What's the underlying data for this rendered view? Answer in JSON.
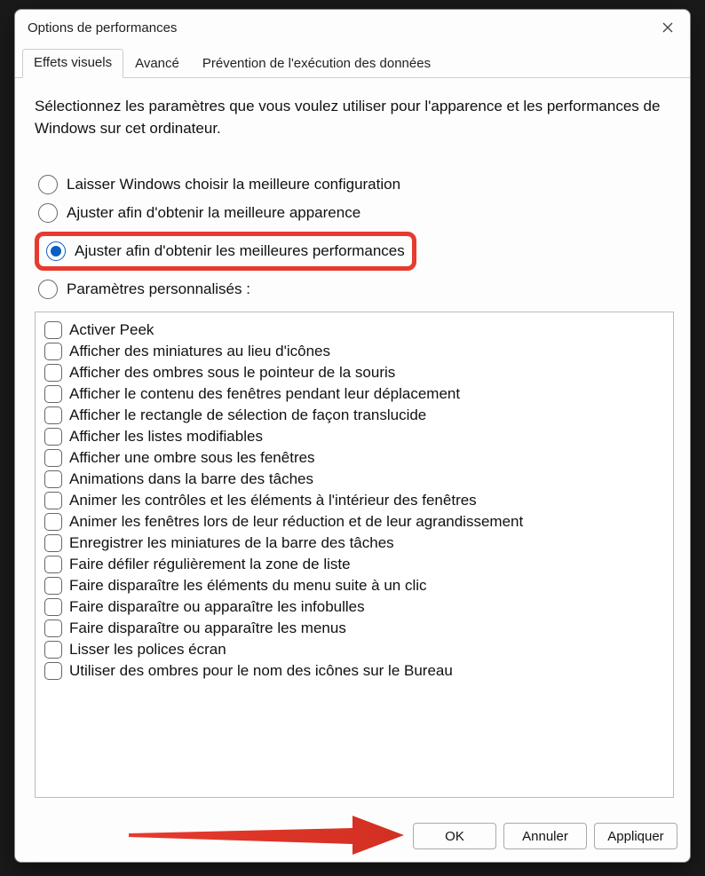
{
  "dialog": {
    "title": "Options de performances",
    "tabs": [
      {
        "label": "Effets visuels",
        "active": true
      },
      {
        "label": "Avancé",
        "active": false
      },
      {
        "label": "Prévention de l'exécution des données",
        "active": false
      }
    ],
    "intro": "Sélectionnez les paramètres que vous voulez utiliser pour l'apparence et les performances de Windows sur cet ordinateur.",
    "radios": [
      {
        "label": "Laisser Windows choisir la meilleure configuration",
        "selected": false,
        "highlighted": false
      },
      {
        "label": "Ajuster afin d'obtenir la meilleure apparence",
        "selected": false,
        "highlighted": false
      },
      {
        "label": "Ajuster afin d'obtenir les meilleures performances",
        "selected": true,
        "highlighted": true
      },
      {
        "label": "Paramètres personnalisés :",
        "selected": false,
        "highlighted": false
      }
    ],
    "checkboxes": [
      "Activer Peek",
      "Afficher des miniatures au lieu d'icônes",
      "Afficher des ombres sous le pointeur de la souris",
      "Afficher le contenu des fenêtres pendant leur déplacement",
      "Afficher le rectangle de sélection de façon translucide",
      "Afficher les listes modifiables",
      "Afficher une ombre sous les fenêtres",
      "Animations dans la barre des tâches",
      "Animer les contrôles et les éléments à l'intérieur des fenêtres",
      "Animer les fenêtres lors de leur réduction et de leur agrandissement",
      "Enregistrer les miniatures de la barre des tâches",
      "Faire défiler régulièrement la zone de liste",
      "Faire disparaître les éléments du menu suite à un clic",
      "Faire disparaître ou apparaître les infobulles",
      "Faire disparaître ou apparaître les menus",
      "Lisser les polices écran",
      "Utiliser des ombres pour le nom des icônes sur le Bureau"
    ],
    "buttons": {
      "ok": "OK",
      "cancel": "Annuler",
      "apply": "Appliquer"
    }
  },
  "annotation": {
    "arrow_color": "#e63b2e"
  }
}
